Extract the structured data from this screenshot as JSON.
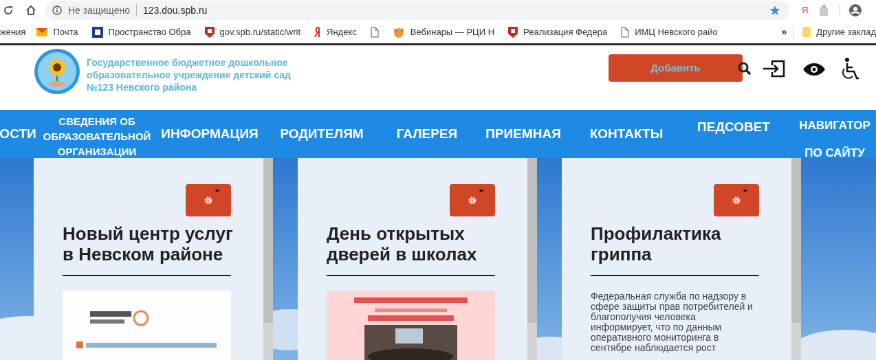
{
  "browser": {
    "security_label": "Не защищено",
    "url": "123.dou.spb.ru",
    "bookmarks": [
      {
        "label": "жения",
        "kind": "none"
      },
      {
        "label": "Почта",
        "kind": "mail"
      },
      {
        "label": "Пространство Обра",
        "kind": "book"
      },
      {
        "label": "gov.spb.ru/static/writ",
        "kind": "crest"
      },
      {
        "label": "Яндекс",
        "kind": "yandex"
      },
      {
        "kind": "page"
      },
      {
        "label": "Вебинары — РЦИ Н",
        "kind": "fox"
      },
      {
        "label": "Реализация Федера",
        "kind": "crest"
      },
      {
        "label": "ИМЦ Невского райо",
        "kind": "page"
      }
    ],
    "more": "»",
    "other_bookmarks": "Другие заклад",
    "yandex_letter": "Я"
  },
  "site": {
    "org_name": "Государственное бюджетное дошкольное образовательное учреждение детский сад №123 Невского района",
    "add_button": "Добавить",
    "nav": [
      {
        "lines": [
          "ОСТИ"
        ],
        "kind": "single"
      },
      {
        "lines": [
          "СВЕДЕНИЯ ОБ",
          "ОБРАЗОВАТЕЛЬНОЙ",
          "ОРГАНИЗАЦИИ"
        ],
        "kind": "small"
      },
      {
        "lines": [
          "ИНФОРМАЦИЯ"
        ],
        "kind": "single"
      },
      {
        "lines": [
          "РОДИТЕЛЯМ"
        ],
        "kind": "single"
      },
      {
        "lines": [
          "ГАЛЕРЕЯ"
        ],
        "kind": "single"
      },
      {
        "lines": [
          "ПРИЕМНАЯ"
        ],
        "kind": "single"
      },
      {
        "lines": [
          "КОНТАКТЫ"
        ],
        "kind": "single"
      },
      {
        "lines": [
          "ПЕДСОВЕТ"
        ],
        "kind": "high"
      },
      {
        "lines": [
          "НАВИГАТОР",
          "ПО САЙТУ"
        ],
        "kind": "low"
      }
    ],
    "cards": [
      {
        "title": "Новый центр услуг в Невском районе",
        "kind": "picture"
      },
      {
        "title": "День открытых дверей в школах",
        "kind": "picture"
      },
      {
        "title": "Профилактика гриппа",
        "kind": "text",
        "text": "Федеральная служба по надзору в сфере защиты прав потребителей и благополучия человека информирует, что по данным оперативного мониторинга в сентябре наблюдается рост"
      }
    ]
  }
}
